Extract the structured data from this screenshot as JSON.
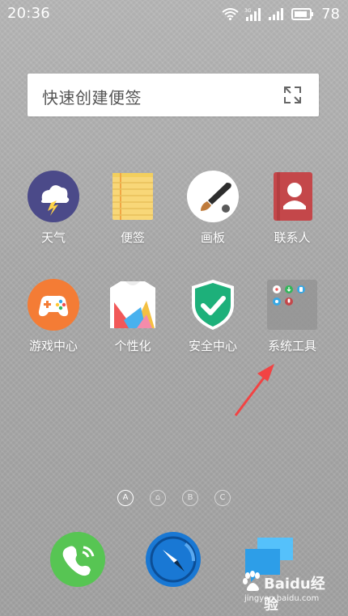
{
  "status": {
    "time": "20:36",
    "battery": "78"
  },
  "widget": {
    "text": "快速创建便签"
  },
  "apps": {
    "weather": "天气",
    "notes": "便签",
    "drawing": "画板",
    "contacts": "联系人",
    "gamecenter": "游戏中心",
    "personalization": "个性化",
    "security": "安全中心",
    "systemtools": "系统工具"
  },
  "page_indicators": [
    "A",
    "⌂",
    "B",
    "C"
  ],
  "watermark": {
    "brand": "Baidu经验",
    "url": "jingyan.baidu.com"
  },
  "colors": {
    "weather": "#4b4a89",
    "notes": "#f8d778",
    "contacts": "#c4474a",
    "games": "#f47c35",
    "security": "#1db07a",
    "phone": "#57c553",
    "browser": "#1978d4",
    "messages": "#2d9ee8"
  }
}
